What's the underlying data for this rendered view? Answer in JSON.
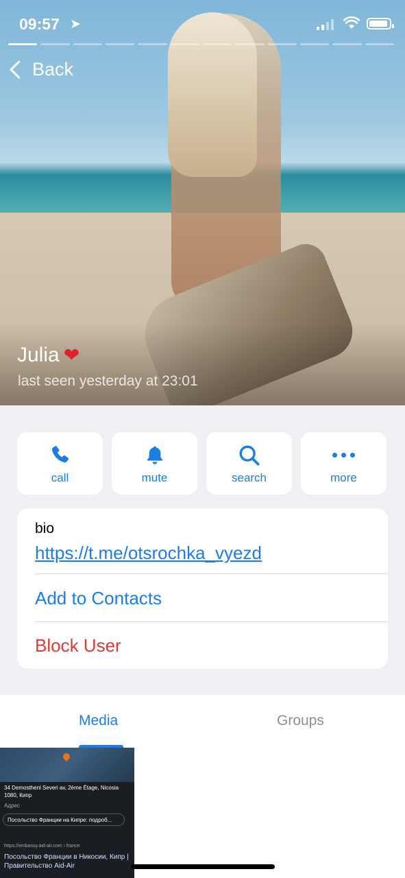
{
  "status_bar": {
    "time": "09:57"
  },
  "nav": {
    "back_label": "Back"
  },
  "profile": {
    "name": "Julia",
    "heart": "❤️",
    "last_seen": "last seen yesterday at 23:01"
  },
  "actions": [
    {
      "label": "call",
      "icon": "phone-icon"
    },
    {
      "label": "mute",
      "icon": "bell-icon"
    },
    {
      "label": "search",
      "icon": "search-icon"
    },
    {
      "label": "more",
      "icon": "more-icon"
    }
  ],
  "info": {
    "bio_label": "bio",
    "bio_link": "https://t.me/otsrochka_vyezd",
    "add_contact": "Add to Contacts",
    "block_user": "Block User"
  },
  "tabs": [
    {
      "label": "Media",
      "active": true
    },
    {
      "label": "Groups",
      "active": false
    }
  ],
  "media_thumb": {
    "address": "34 Demosthenl Severi av, 2ème Étage, Nicosia 1080, Кипр",
    "address_label": "Адрес",
    "chip": "Посольство Франции на Кипре: подроб...",
    "source": "https://embassy.aid-air.com › france",
    "headline": "Посольство Франции в Никосии, Кипр | Правительство Aid-Air"
  },
  "colors": {
    "accent": "#1b7ee3",
    "destructive": "#e23a32",
    "background": "#efeff4"
  }
}
